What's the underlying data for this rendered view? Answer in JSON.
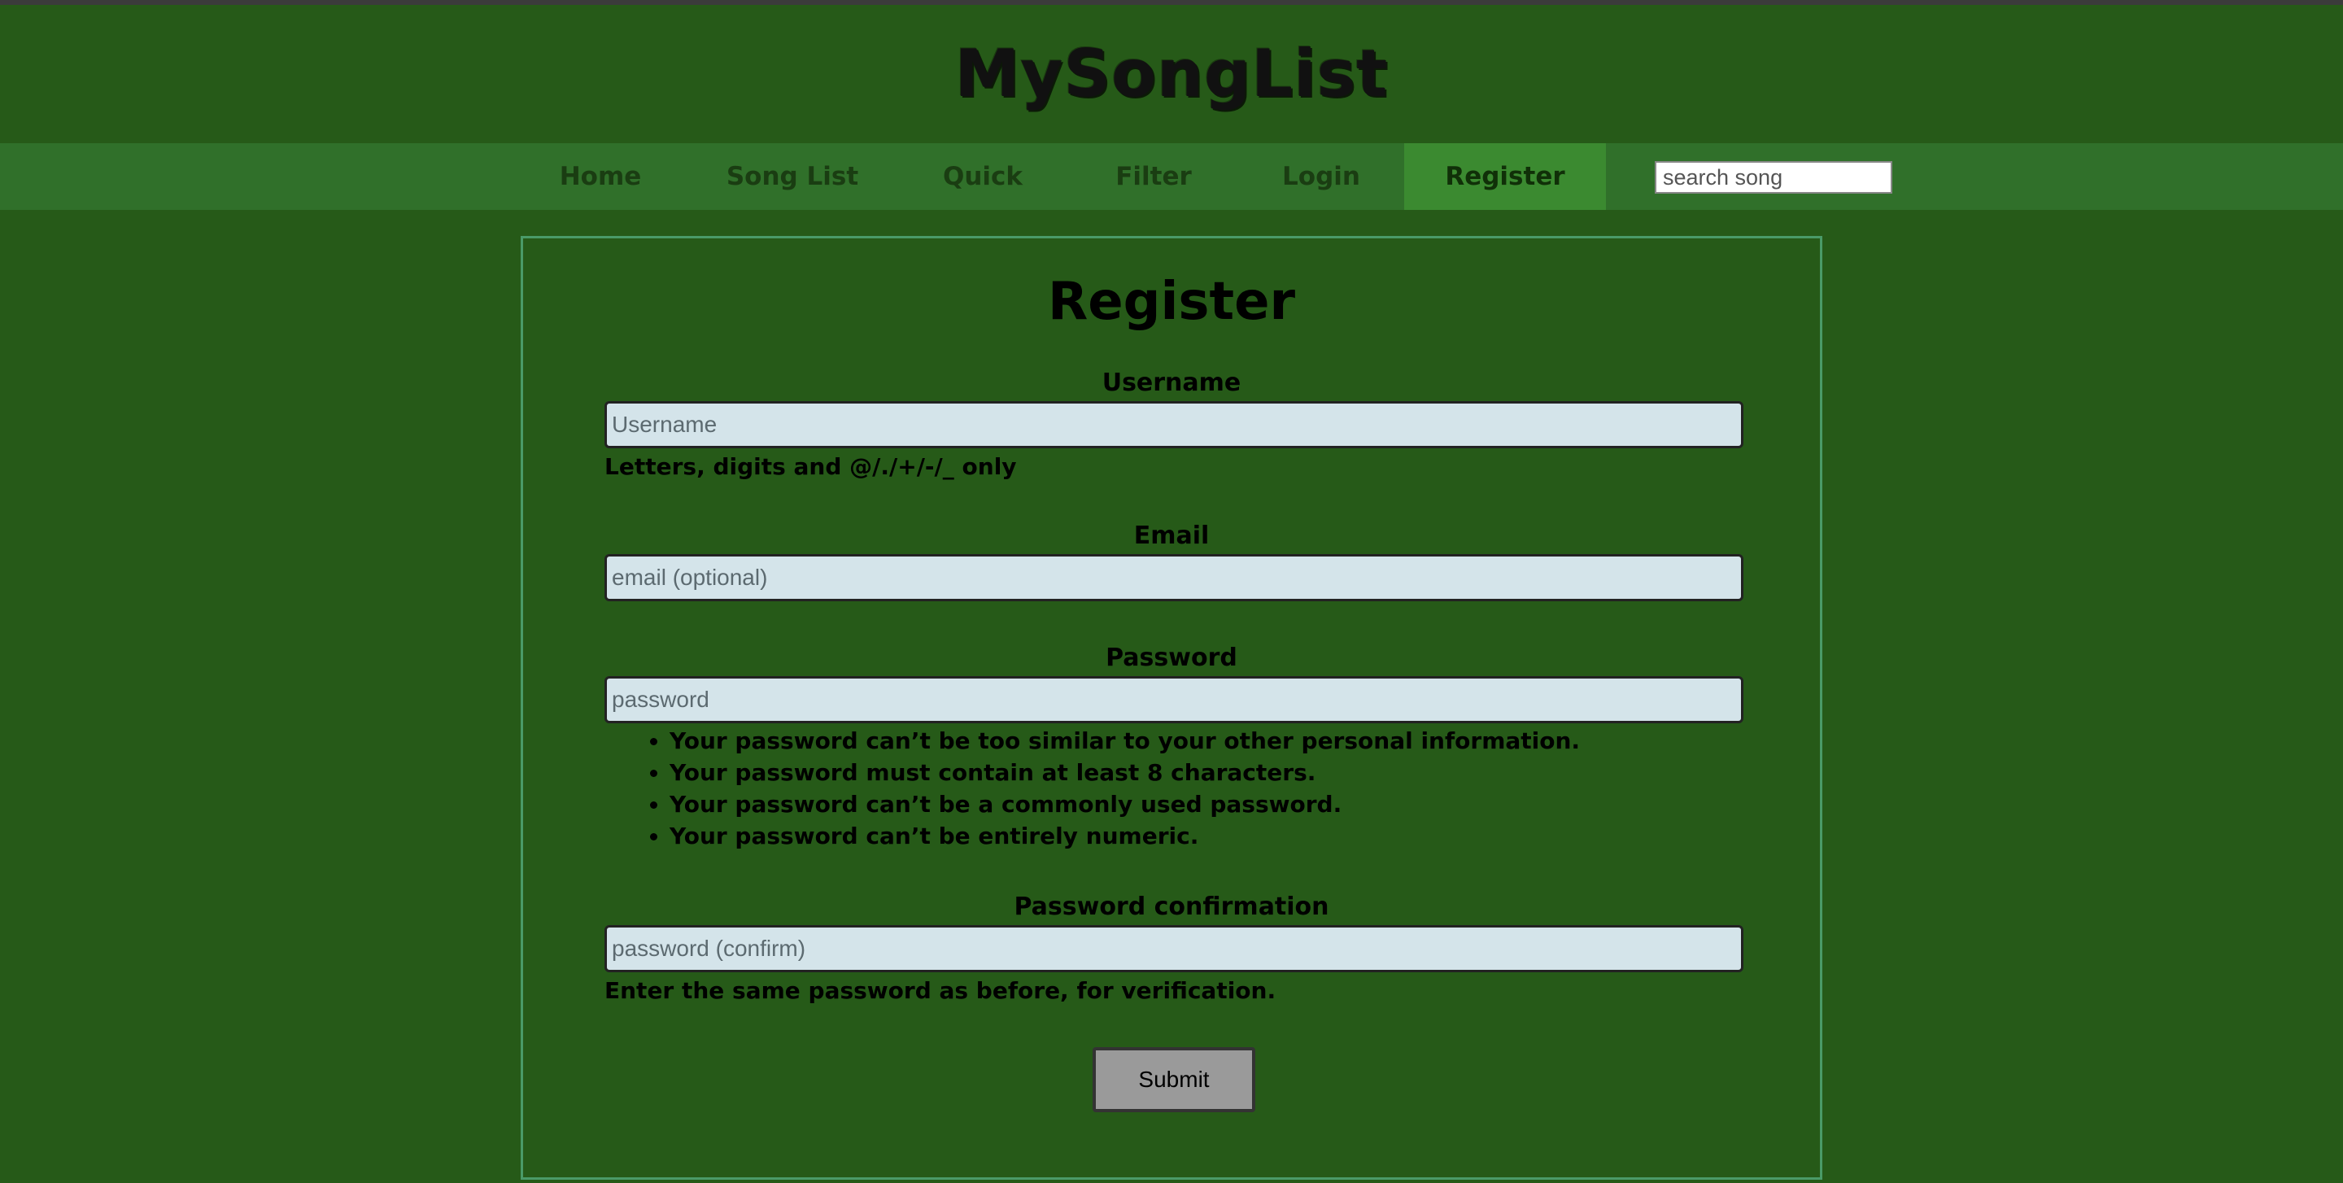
{
  "site": {
    "title": "MySongList"
  },
  "nav": {
    "items": [
      {
        "label": "Home"
      },
      {
        "label": "Song List"
      },
      {
        "label": "Quick"
      },
      {
        "label": "Filter"
      },
      {
        "label": "Login"
      },
      {
        "label": "Register",
        "active": true
      }
    ],
    "search_placeholder": "search song"
  },
  "form": {
    "title": "Register",
    "username": {
      "label": "Username",
      "placeholder": "Username",
      "help": "Letters, digits and @/./+/-/_ only"
    },
    "email": {
      "label": "Email",
      "placeholder": "email (optional)"
    },
    "password": {
      "label": "Password",
      "placeholder": "password",
      "rules": [
        "Your password can’t be too similar to your other personal information.",
        "Your password must contain at least 8 characters.",
        "Your password can’t be a commonly used password.",
        "Your password can’t be entirely numeric."
      ]
    },
    "password_confirm": {
      "label": "Password confirmation",
      "placeholder": "password (confirm)",
      "help": "Enter the same password as before, for verification."
    },
    "submit_label": "Submit"
  },
  "colors": {
    "background": "#265a18",
    "navbar": "#30702a",
    "nav_active": "#3b8a30",
    "card_border": "#4a9a68",
    "input_bg": "#d4e4ea",
    "button_bg": "#9a9a9a"
  }
}
